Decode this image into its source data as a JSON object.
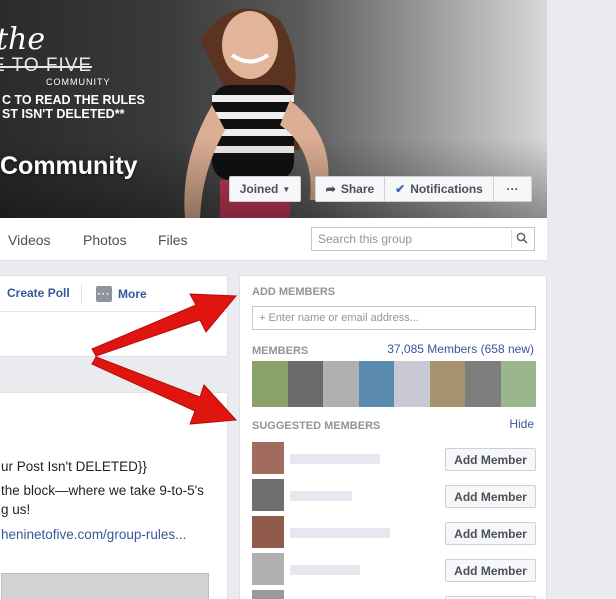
{
  "cover": {
    "logo_the": "the",
    "logo_nine": "E TO FIVE",
    "logo_community": "COMMUNITY",
    "rules_line1": "C TO READ THE RULES",
    "rules_line2": "ST ISN'T DELETED**",
    "group_name": "Community",
    "buttons": {
      "joined": "Joined",
      "share": "Share",
      "notifications": "Notifications",
      "more": "···"
    }
  },
  "nav": {
    "tabs": [
      "Videos",
      "Photos",
      "Files"
    ],
    "search_placeholder": "Search this group"
  },
  "composer": {
    "create_poll": "Create Poll",
    "more": "More"
  },
  "post": {
    "line1": "ur Post Isn't DELETED}}",
    "line2": "the block—where we take 9-to-5's",
    "line3": "g us!",
    "link": "heninetofive.com/group-rules..."
  },
  "sidebar": {
    "add_members_title": "ADD MEMBERS",
    "add_members_placeholder": "+ Enter name or email address...",
    "members_title": "MEMBERS",
    "members_count": "37,085 Members (658 new)",
    "suggested_title": "SUGGESTED MEMBERS",
    "hide": "Hide",
    "add_member_label": "Add Member"
  },
  "colors": {
    "link": "#365899",
    "arrow": "#e0150f",
    "background": "#e9ebee"
  }
}
